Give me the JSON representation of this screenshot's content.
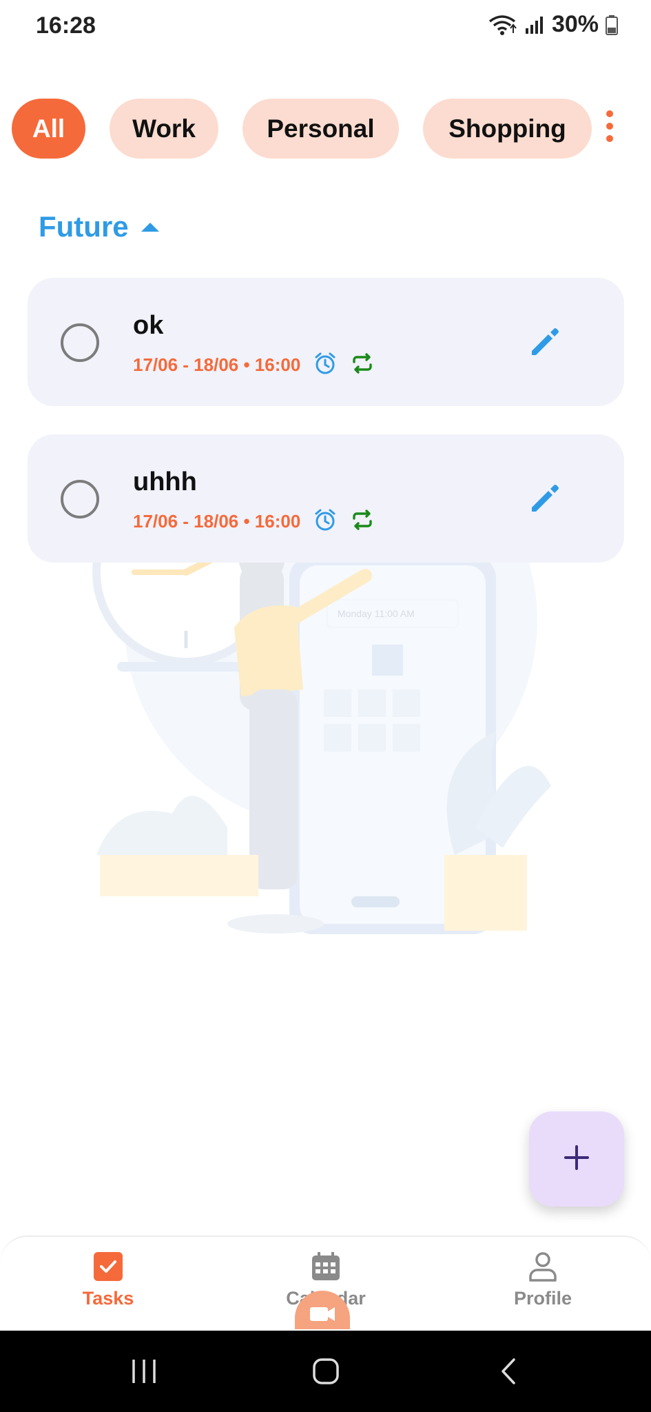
{
  "status_bar": {
    "time": "16:28",
    "battery": "30%",
    "icons": [
      "wifi-icon",
      "signal-icon",
      "battery-icon"
    ]
  },
  "filters": {
    "chips": [
      "All",
      "Work",
      "Personal",
      "Shopping"
    ],
    "selected": "All",
    "more_icon": "more-vertical-icon"
  },
  "section": {
    "title": "Future",
    "caret_icon": "caret-up-icon"
  },
  "tasks": [
    {
      "title": "ok",
      "date": "17/06 - 18/06 • 16:00",
      "icons": [
        "alarm-icon",
        "repeat-icon",
        "edit-icon"
      ]
    },
    {
      "title": "uhhh",
      "date": "17/06 - 18/06 • 16:00",
      "icons": [
        "alarm-icon",
        "repeat-icon",
        "edit-icon"
      ]
    }
  ],
  "illustration": {
    "phone_text": "Monday 11:00 AM"
  },
  "fab": {
    "icon": "plus-icon"
  },
  "bottom_nav": {
    "items": [
      {
        "label": "Tasks",
        "icon": "tasks-check-icon",
        "active": true
      },
      {
        "label": "Calendar",
        "icon": "calendar-icon",
        "active": false
      },
      {
        "label": "Profile",
        "icon": "profile-icon",
        "active": false
      }
    ]
  },
  "colors": {
    "accent": "#f56a3a",
    "chip_bg": "#fcdcd0",
    "section_blue": "#2f9be6",
    "card_bg": "#f1f2fa",
    "fab_bg": "#e9dcfb",
    "repeat_green": "#1a8a1a"
  },
  "system_nav": {
    "icons": [
      "recents-icon",
      "home-icon",
      "back-icon"
    ]
  }
}
